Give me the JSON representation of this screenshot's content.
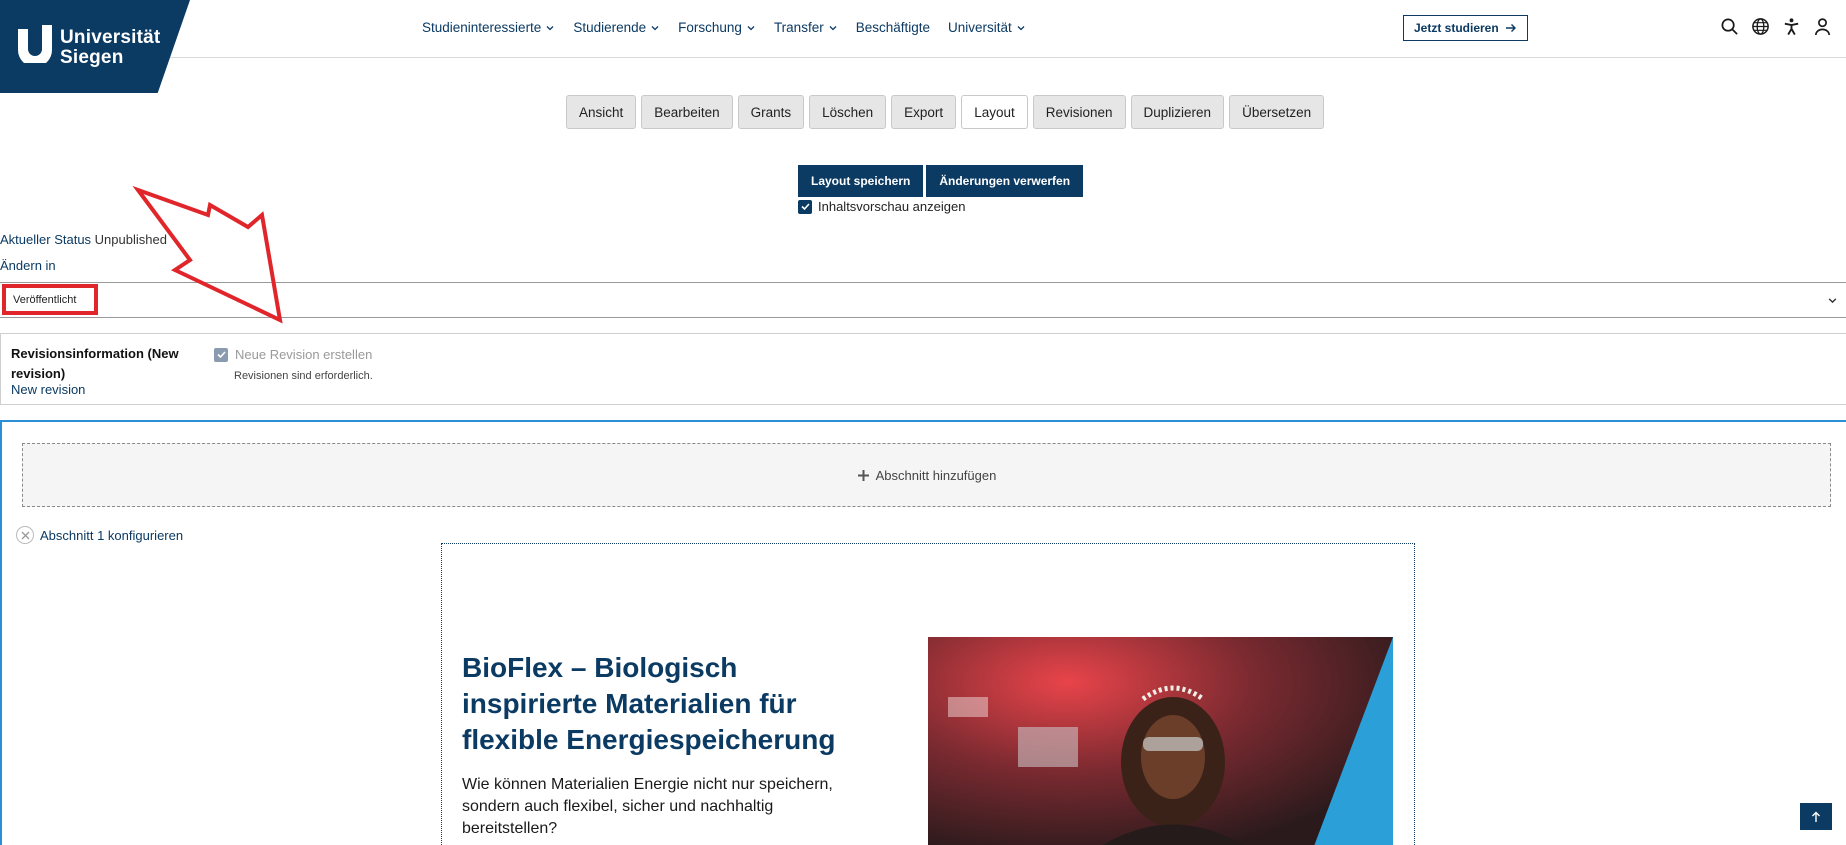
{
  "header": {
    "logo": {
      "line1": "Universität",
      "line2": "Siegen"
    },
    "nav": [
      "Studieninteressierte",
      "Studierende",
      "Forschung",
      "Transfer",
      "Beschäftigte",
      "Universität"
    ],
    "cta": "Jetzt studieren",
    "icons": [
      "search-icon",
      "globe-icon",
      "accessibility-icon",
      "user-icon"
    ]
  },
  "tabs": [
    "Ansicht",
    "Bearbeiten",
    "Grants",
    "Löschen",
    "Export",
    "Layout",
    "Revisionen",
    "Duplizieren",
    "Übersetzen"
  ],
  "active_tab": "Layout",
  "actions": {
    "save": "Layout speichern",
    "discard": "Änderungen verwerfen",
    "preview": "Inhaltsvorschau anzeigen"
  },
  "status": {
    "label": "Aktueller Status",
    "value": "Unpublished",
    "change_label": "Ändern in",
    "selected": "Veröffentlicht"
  },
  "revision": {
    "title": "Revisionsinformation (New revision)",
    "link": "New revision",
    "checkbox": "Neue Revision erstellen",
    "help": "Revisionen sind erforderlich."
  },
  "builder": {
    "add_section": "Abschnitt hinzufügen",
    "configure": "Abschnitt 1 konfigurieren",
    "hero_title": "BioFlex – Biologisch inspirierte Materialien für flexible Energiespeicherung",
    "hero_text": "Wie können Materialien Energie nicht nur speichern, sondern auch flexibel, sicher und nachhaltig bereitstellen?"
  },
  "colors": {
    "brand": "#0b3a63",
    "accent": "#2a8fd6",
    "annotation": "#e0262b"
  }
}
